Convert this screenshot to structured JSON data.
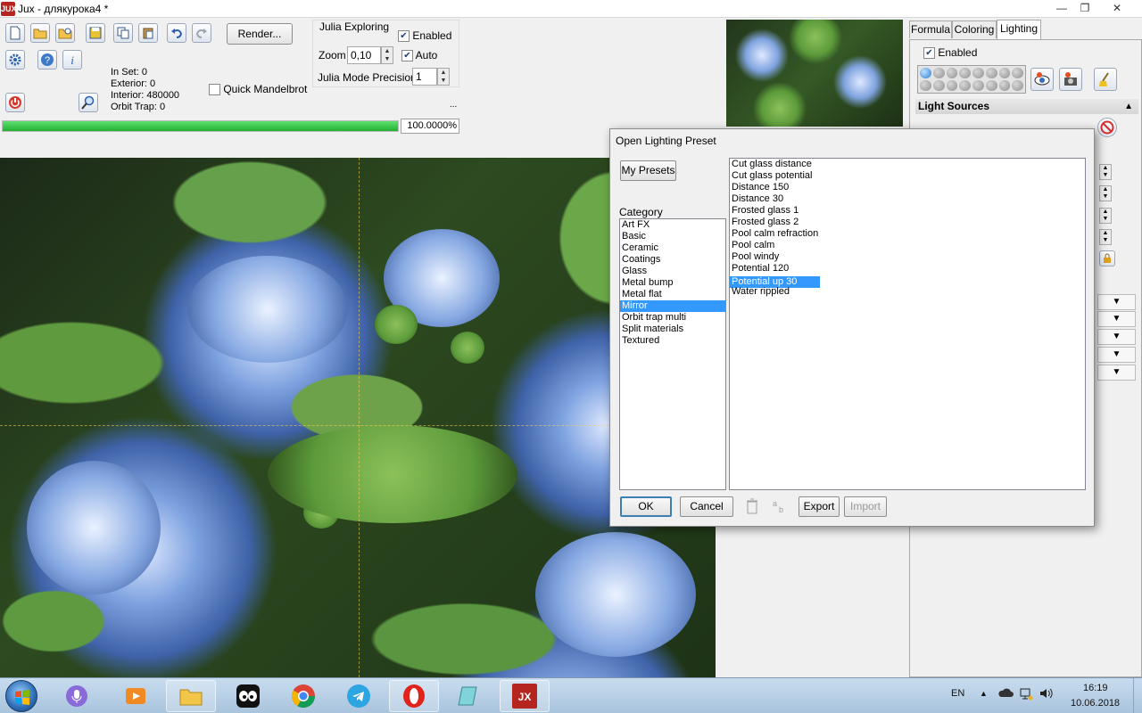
{
  "window": {
    "title": "Jux - длякурока4 *",
    "app_icon_text": "JUX",
    "min_glyph": "—",
    "max_glyph": "❐",
    "close_glyph": "✕"
  },
  "toolbar": {
    "render_label": "Render...",
    "ellipsis": "..."
  },
  "stats": {
    "in_set": "In Set: 0",
    "exterior": "Exterior: 0",
    "interior": "Interior: 480000",
    "orbit_trap": "Orbit Trap: 0"
  },
  "quick_mandelbrot": {
    "label": "Quick Mandelbrot",
    "checked": false
  },
  "julia": {
    "group_label": "Julia Exploring",
    "enabled_label": "Enabled",
    "zoom_label": "Zoom",
    "zoom_value": "0,10",
    "auto_label": "Auto",
    "precision_label": "Julia Mode Precision",
    "precision_value": "1"
  },
  "progress": {
    "fraction": 1.0,
    "text": "100.0000%"
  },
  "right_panel": {
    "tabs": [
      {
        "label": "Formula",
        "active": false
      },
      {
        "label": "Coloring",
        "active": false
      },
      {
        "label": "Lighting",
        "active": true
      }
    ],
    "enabled_label": "Enabled",
    "light_sources_label": "Light Sources",
    "light_sources_arrow": "▲"
  },
  "dialog": {
    "title": "Open Lighting Preset",
    "my_presets_label": "My Presets",
    "category_label": "Category",
    "categories": [
      "Art FX",
      "Basic",
      "Ceramic",
      "Coatings",
      "Glass",
      "Metal bump",
      "Metal flat",
      "Mirror",
      "Orbit trap multi",
      "Split materials",
      "Textured"
    ],
    "selected_category_index": 7,
    "presets": [
      "Cut glass distance",
      "Cut glass potential",
      "Distance 150",
      "Distance 30",
      "Frosted glass 1",
      "Frosted glass 2",
      "Pool calm refraction",
      "Pool calm",
      "Pool windy",
      "Potential 120",
      "Potential up 30",
      "Water rippled"
    ],
    "selected_preset_index": 10,
    "ok_label": "OK",
    "cancel_label": "Cancel",
    "export_label": "Export",
    "import_label": "Import"
  },
  "taskbar": {
    "lang": "EN",
    "time": "16:19",
    "date": "10.06.2018"
  },
  "colors": {
    "selection": "#3399ff",
    "progress": "#22b032",
    "titlebar_icon": "#b5241f"
  }
}
